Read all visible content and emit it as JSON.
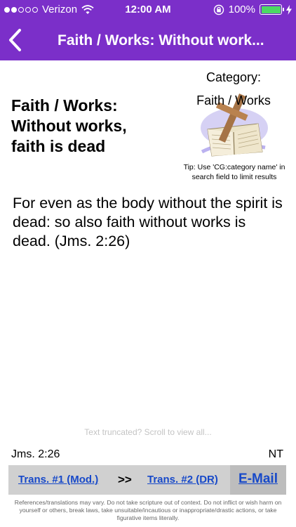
{
  "status_bar": {
    "carrier": "Verizon",
    "time": "12:00 AM",
    "battery_percent": "100%",
    "signal_bars_filled": 2,
    "signal_bars_total": 5,
    "battery_color": "#4cd964"
  },
  "nav": {
    "title": "Faith / Works: Without work...",
    "back_icon": "chevron-left-icon",
    "bar_color": "#7b2fc9"
  },
  "entry": {
    "title": "Faith / Works: Without works, faith is dead",
    "category_label": "Category:",
    "category_name": "Faith / Works",
    "tip": "Tip: Use 'CG:category name' in search field to limit results",
    "verse": "For even as the body without the spirit is dead: so also faith without works is dead. (Jms. 2:26)",
    "truncation_note": "Text truncated? Scroll to view all...",
    "reference": "Jms. 2:26",
    "testament": "NT"
  },
  "bottom_bar": {
    "trans1_label": "Trans. #1 (Mod.)",
    "arrows": ">>",
    "trans2_label": "Trans. #2 (DR)",
    "email_label": "E-Mail",
    "link_color": "#1749c9"
  },
  "disclaimer": "References/translations may vary. Do not take scripture out of context. Do not inflict or wish harm on yourself or others, break laws, take unsuitable/incautious or inappropriate/drastic actions, or take figurative items literally."
}
